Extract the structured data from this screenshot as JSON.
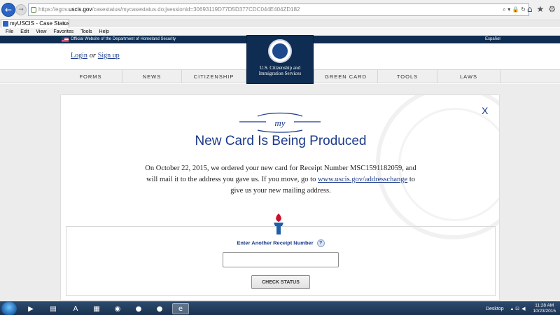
{
  "browser": {
    "url_scheme": "https://",
    "url_prefix": "egov.",
    "url_host": "uscis.gov",
    "url_path": "/casestatus/mycasestatus.do;jsessionid=30693119D77D5D377CDC044E404ZD182",
    "tab_title": "myUSCIS - Case Status",
    "menu": [
      "File",
      "Edit",
      "View",
      "Favorites",
      "Tools",
      "Help"
    ]
  },
  "site": {
    "gov_banner": "Official Website of the Department of Homeland Security",
    "language_link": "Español",
    "login": "Login",
    "or": "or",
    "signup": "Sign up",
    "logo_line1": "U.S. Citizenship and",
    "logo_line2": "Immigration Services",
    "nav": [
      "FORMS",
      "NEWS",
      "CITIZENSHIP",
      "GREEN CARD",
      "TOOLS",
      "LAWS"
    ]
  },
  "status": {
    "close_label": "X",
    "my_logo_text": "my",
    "title": "New Card Is Being Produced",
    "message_before": "On October 22, 2015, we ordered your new card for Receipt Number MSC1591182059, and will mail it to the address you gave us. If you move, go to ",
    "message_link": "www.uscis.gov/addresschange",
    "message_after": " to give us your new mailing address."
  },
  "form": {
    "label": "Enter Another Receipt Number",
    "help": "?",
    "input_value": "",
    "button": "CHECK STATUS"
  },
  "taskbar": {
    "desktop": "Desktop",
    "time": "11:28 AM",
    "date": "10/23/2015"
  }
}
